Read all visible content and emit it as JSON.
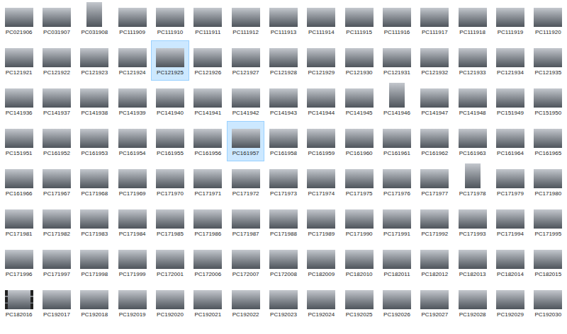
{
  "file_grid": {
    "items": [
      {
        "label": "PC021906",
        "selected": false,
        "kind": "photo"
      },
      {
        "label": "PC031907",
        "selected": false,
        "kind": "photo"
      },
      {
        "label": "PC031908",
        "selected": false,
        "kind": "portrait"
      },
      {
        "label": "PC111909",
        "selected": false,
        "kind": "photo"
      },
      {
        "label": "PC111910",
        "selected": false,
        "kind": "photo"
      },
      {
        "label": "PC111911",
        "selected": false,
        "kind": "photo"
      },
      {
        "label": "PC111912",
        "selected": false,
        "kind": "photo"
      },
      {
        "label": "PC111913",
        "selected": false,
        "kind": "photo"
      },
      {
        "label": "PC111914",
        "selected": false,
        "kind": "photo"
      },
      {
        "label": "PC111915",
        "selected": false,
        "kind": "photo"
      },
      {
        "label": "PC111916",
        "selected": false,
        "kind": "photo"
      },
      {
        "label": "PC111917",
        "selected": false,
        "kind": "photo"
      },
      {
        "label": "PC111918",
        "selected": false,
        "kind": "photo"
      },
      {
        "label": "PC111919",
        "selected": false,
        "kind": "photo"
      },
      {
        "label": "PC111920",
        "selected": false,
        "kind": "photo"
      },
      {
        "label": "PC121921",
        "selected": false,
        "kind": "photo"
      },
      {
        "label": "PC121922",
        "selected": false,
        "kind": "photo"
      },
      {
        "label": "PC121923",
        "selected": false,
        "kind": "photo"
      },
      {
        "label": "PC121924",
        "selected": false,
        "kind": "photo"
      },
      {
        "label": "PC121925",
        "selected": true,
        "kind": "photo"
      },
      {
        "label": "PC121926",
        "selected": false,
        "kind": "photo"
      },
      {
        "label": "PC121927",
        "selected": false,
        "kind": "photo"
      },
      {
        "label": "PC121928",
        "selected": false,
        "kind": "photo"
      },
      {
        "label": "PC121929",
        "selected": false,
        "kind": "photo"
      },
      {
        "label": "PC121930",
        "selected": false,
        "kind": "photo"
      },
      {
        "label": "PC121931",
        "selected": false,
        "kind": "photo"
      },
      {
        "label": "PC121932",
        "selected": false,
        "kind": "photo"
      },
      {
        "label": "PC121933",
        "selected": false,
        "kind": "photo"
      },
      {
        "label": "PC121934",
        "selected": false,
        "kind": "photo"
      },
      {
        "label": "PC121935",
        "selected": false,
        "kind": "photo"
      },
      {
        "label": "PC141936",
        "selected": false,
        "kind": "photo"
      },
      {
        "label": "PC141937",
        "selected": false,
        "kind": "photo"
      },
      {
        "label": "PC141938",
        "selected": false,
        "kind": "photo"
      },
      {
        "label": "PC141939",
        "selected": false,
        "kind": "photo"
      },
      {
        "label": "PC141940",
        "selected": false,
        "kind": "photo"
      },
      {
        "label": "PC141941",
        "selected": false,
        "kind": "photo"
      },
      {
        "label": "PC141942",
        "selected": false,
        "kind": "photo"
      },
      {
        "label": "PC141943",
        "selected": false,
        "kind": "photo"
      },
      {
        "label": "PC141944",
        "selected": false,
        "kind": "photo"
      },
      {
        "label": "PC141945",
        "selected": false,
        "kind": "photo"
      },
      {
        "label": "PC141946",
        "selected": false,
        "kind": "portrait"
      },
      {
        "label": "PC141947",
        "selected": false,
        "kind": "photo"
      },
      {
        "label": "PC141948",
        "selected": false,
        "kind": "photo"
      },
      {
        "label": "PC151949",
        "selected": false,
        "kind": "photo"
      },
      {
        "label": "PC151950",
        "selected": false,
        "kind": "photo"
      },
      {
        "label": "PC151951",
        "selected": false,
        "kind": "photo"
      },
      {
        "label": "PC161952",
        "selected": false,
        "kind": "photo"
      },
      {
        "label": "PC161953",
        "selected": false,
        "kind": "photo"
      },
      {
        "label": "PC161954",
        "selected": false,
        "kind": "photo"
      },
      {
        "label": "PC161955",
        "selected": false,
        "kind": "photo"
      },
      {
        "label": "PC161956",
        "selected": false,
        "kind": "photo"
      },
      {
        "label": "PC161957",
        "selected": true,
        "kind": "photo"
      },
      {
        "label": "PC161958",
        "selected": false,
        "kind": "photo"
      },
      {
        "label": "PC161959",
        "selected": false,
        "kind": "photo"
      },
      {
        "label": "PC161960",
        "selected": false,
        "kind": "photo"
      },
      {
        "label": "PC161961",
        "selected": false,
        "kind": "photo"
      },
      {
        "label": "PC161962",
        "selected": false,
        "kind": "photo"
      },
      {
        "label": "PC161963",
        "selected": false,
        "kind": "photo"
      },
      {
        "label": "PC161964",
        "selected": false,
        "kind": "photo"
      },
      {
        "label": "PC161965",
        "selected": false,
        "kind": "photo"
      },
      {
        "label": "PC161966",
        "selected": false,
        "kind": "photo"
      },
      {
        "label": "PC171967",
        "selected": false,
        "kind": "photo"
      },
      {
        "label": "PC171968",
        "selected": false,
        "kind": "photo"
      },
      {
        "label": "PC171969",
        "selected": false,
        "kind": "photo"
      },
      {
        "label": "PC171970",
        "selected": false,
        "kind": "photo"
      },
      {
        "label": "PC171971",
        "selected": false,
        "kind": "photo"
      },
      {
        "label": "PC171972",
        "selected": false,
        "kind": "photo"
      },
      {
        "label": "PC171973",
        "selected": false,
        "kind": "photo"
      },
      {
        "label": "PC171974",
        "selected": false,
        "kind": "photo"
      },
      {
        "label": "PC171975",
        "selected": false,
        "kind": "photo"
      },
      {
        "label": "PC171976",
        "selected": false,
        "kind": "photo"
      },
      {
        "label": "PC171977",
        "selected": false,
        "kind": "photo"
      },
      {
        "label": "PC171978",
        "selected": false,
        "kind": "portrait"
      },
      {
        "label": "PC171979",
        "selected": false,
        "kind": "photo"
      },
      {
        "label": "PC171980",
        "selected": false,
        "kind": "photo"
      },
      {
        "label": "PC171981",
        "selected": false,
        "kind": "photo"
      },
      {
        "label": "PC171982",
        "selected": false,
        "kind": "photo"
      },
      {
        "label": "PC171983",
        "selected": false,
        "kind": "photo"
      },
      {
        "label": "PC171984",
        "selected": false,
        "kind": "photo"
      },
      {
        "label": "PC171985",
        "selected": false,
        "kind": "photo"
      },
      {
        "label": "PC171986",
        "selected": false,
        "kind": "photo"
      },
      {
        "label": "PC171987",
        "selected": false,
        "kind": "photo"
      },
      {
        "label": "PC171988",
        "selected": false,
        "kind": "photo"
      },
      {
        "label": "PC171989",
        "selected": false,
        "kind": "photo"
      },
      {
        "label": "PC171990",
        "selected": false,
        "kind": "photo"
      },
      {
        "label": "PC171991",
        "selected": false,
        "kind": "photo"
      },
      {
        "label": "PC171992",
        "selected": false,
        "kind": "photo"
      },
      {
        "label": "PC171993",
        "selected": false,
        "kind": "photo"
      },
      {
        "label": "PC171994",
        "selected": false,
        "kind": "photo"
      },
      {
        "label": "PC171995",
        "selected": false,
        "kind": "photo"
      },
      {
        "label": "PC171996",
        "selected": false,
        "kind": "photo"
      },
      {
        "label": "PC171997",
        "selected": false,
        "kind": "photo"
      },
      {
        "label": "PC171998",
        "selected": false,
        "kind": "photo"
      },
      {
        "label": "PC171999",
        "selected": false,
        "kind": "photo"
      },
      {
        "label": "PC172001",
        "selected": false,
        "kind": "photo"
      },
      {
        "label": "PC172006",
        "selected": false,
        "kind": "photo"
      },
      {
        "label": "PC172007",
        "selected": false,
        "kind": "photo"
      },
      {
        "label": "PC172008",
        "selected": false,
        "kind": "photo"
      },
      {
        "label": "PC182009",
        "selected": false,
        "kind": "photo"
      },
      {
        "label": "PC182010",
        "selected": false,
        "kind": "photo"
      },
      {
        "label": "PC182011",
        "selected": false,
        "kind": "photo"
      },
      {
        "label": "PC182012",
        "selected": false,
        "kind": "photo"
      },
      {
        "label": "PC182013",
        "selected": false,
        "kind": "photo"
      },
      {
        "label": "PC182014",
        "selected": false,
        "kind": "photo"
      },
      {
        "label": "PC182015",
        "selected": false,
        "kind": "photo"
      },
      {
        "label": "PC182016",
        "selected": false,
        "kind": "video"
      },
      {
        "label": "PC192017",
        "selected": false,
        "kind": "photo"
      },
      {
        "label": "PC192018",
        "selected": false,
        "kind": "photo"
      },
      {
        "label": "PC192019",
        "selected": false,
        "kind": "photo"
      },
      {
        "label": "PC192020",
        "selected": false,
        "kind": "photo"
      },
      {
        "label": "PC192021",
        "selected": false,
        "kind": "photo"
      },
      {
        "label": "PC192022",
        "selected": false,
        "kind": "photo"
      },
      {
        "label": "PC192023",
        "selected": false,
        "kind": "photo"
      },
      {
        "label": "PC192024",
        "selected": false,
        "kind": "photo"
      },
      {
        "label": "PC192025",
        "selected": false,
        "kind": "photo"
      },
      {
        "label": "PC192026",
        "selected": false,
        "kind": "photo"
      },
      {
        "label": "PC192027",
        "selected": false,
        "kind": "photo"
      },
      {
        "label": "PC192028",
        "selected": false,
        "kind": "photo"
      },
      {
        "label": "PC192029",
        "selected": false,
        "kind": "photo"
      },
      {
        "label": "PC192030",
        "selected": false,
        "kind": "photo"
      }
    ]
  }
}
